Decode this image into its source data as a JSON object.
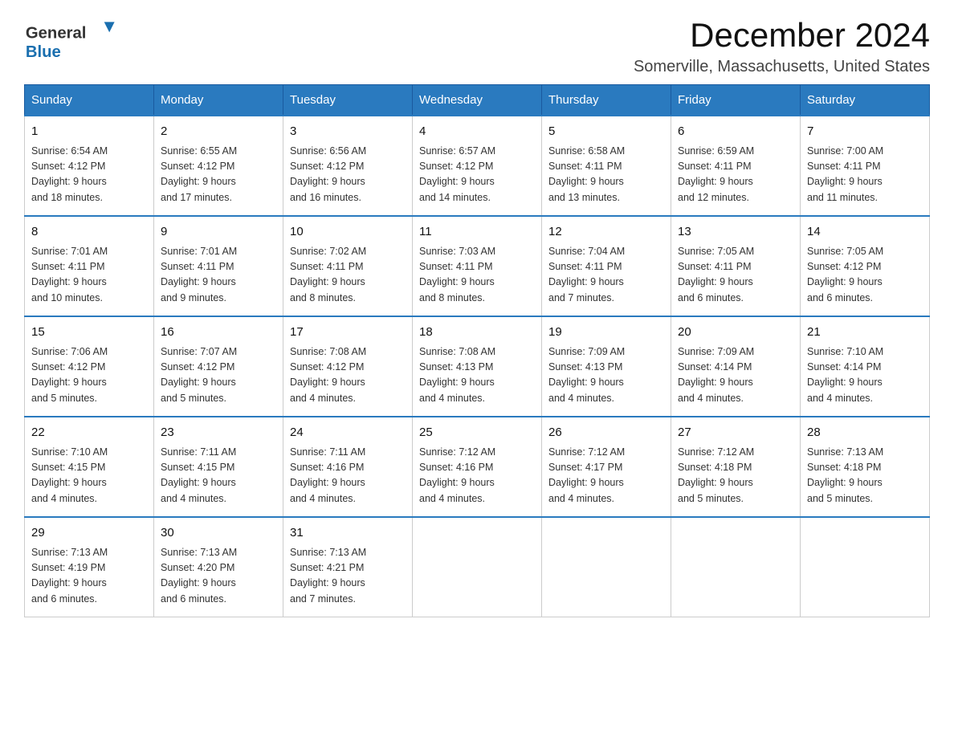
{
  "header": {
    "logo_line1": "General",
    "logo_line2": "Blue",
    "title": "December 2024",
    "subtitle": "Somerville, Massachusetts, United States"
  },
  "days_of_week": [
    "Sunday",
    "Monday",
    "Tuesday",
    "Wednesday",
    "Thursday",
    "Friday",
    "Saturday"
  ],
  "weeks": [
    [
      {
        "day": "1",
        "sunrise": "6:54 AM",
        "sunset": "4:12 PM",
        "daylight": "9 hours and 18 minutes."
      },
      {
        "day": "2",
        "sunrise": "6:55 AM",
        "sunset": "4:12 PM",
        "daylight": "9 hours and 17 minutes."
      },
      {
        "day": "3",
        "sunrise": "6:56 AM",
        "sunset": "4:12 PM",
        "daylight": "9 hours and 16 minutes."
      },
      {
        "day": "4",
        "sunrise": "6:57 AM",
        "sunset": "4:12 PM",
        "daylight": "9 hours and 14 minutes."
      },
      {
        "day": "5",
        "sunrise": "6:58 AM",
        "sunset": "4:11 PM",
        "daylight": "9 hours and 13 minutes."
      },
      {
        "day": "6",
        "sunrise": "6:59 AM",
        "sunset": "4:11 PM",
        "daylight": "9 hours and 12 minutes."
      },
      {
        "day": "7",
        "sunrise": "7:00 AM",
        "sunset": "4:11 PM",
        "daylight": "9 hours and 11 minutes."
      }
    ],
    [
      {
        "day": "8",
        "sunrise": "7:01 AM",
        "sunset": "4:11 PM",
        "daylight": "9 hours and 10 minutes."
      },
      {
        "day": "9",
        "sunrise": "7:01 AM",
        "sunset": "4:11 PM",
        "daylight": "9 hours and 9 minutes."
      },
      {
        "day": "10",
        "sunrise": "7:02 AM",
        "sunset": "4:11 PM",
        "daylight": "9 hours and 8 minutes."
      },
      {
        "day": "11",
        "sunrise": "7:03 AM",
        "sunset": "4:11 PM",
        "daylight": "9 hours and 8 minutes."
      },
      {
        "day": "12",
        "sunrise": "7:04 AM",
        "sunset": "4:11 PM",
        "daylight": "9 hours and 7 minutes."
      },
      {
        "day": "13",
        "sunrise": "7:05 AM",
        "sunset": "4:11 PM",
        "daylight": "9 hours and 6 minutes."
      },
      {
        "day": "14",
        "sunrise": "7:05 AM",
        "sunset": "4:12 PM",
        "daylight": "9 hours and 6 minutes."
      }
    ],
    [
      {
        "day": "15",
        "sunrise": "7:06 AM",
        "sunset": "4:12 PM",
        "daylight": "9 hours and 5 minutes."
      },
      {
        "day": "16",
        "sunrise": "7:07 AM",
        "sunset": "4:12 PM",
        "daylight": "9 hours and 5 minutes."
      },
      {
        "day": "17",
        "sunrise": "7:08 AM",
        "sunset": "4:12 PM",
        "daylight": "9 hours and 4 minutes."
      },
      {
        "day": "18",
        "sunrise": "7:08 AM",
        "sunset": "4:13 PM",
        "daylight": "9 hours and 4 minutes."
      },
      {
        "day": "19",
        "sunrise": "7:09 AM",
        "sunset": "4:13 PM",
        "daylight": "9 hours and 4 minutes."
      },
      {
        "day": "20",
        "sunrise": "7:09 AM",
        "sunset": "4:14 PM",
        "daylight": "9 hours and 4 minutes."
      },
      {
        "day": "21",
        "sunrise": "7:10 AM",
        "sunset": "4:14 PM",
        "daylight": "9 hours and 4 minutes."
      }
    ],
    [
      {
        "day": "22",
        "sunrise": "7:10 AM",
        "sunset": "4:15 PM",
        "daylight": "9 hours and 4 minutes."
      },
      {
        "day": "23",
        "sunrise": "7:11 AM",
        "sunset": "4:15 PM",
        "daylight": "9 hours and 4 minutes."
      },
      {
        "day": "24",
        "sunrise": "7:11 AM",
        "sunset": "4:16 PM",
        "daylight": "9 hours and 4 minutes."
      },
      {
        "day": "25",
        "sunrise": "7:12 AM",
        "sunset": "4:16 PM",
        "daylight": "9 hours and 4 minutes."
      },
      {
        "day": "26",
        "sunrise": "7:12 AM",
        "sunset": "4:17 PM",
        "daylight": "9 hours and 4 minutes."
      },
      {
        "day": "27",
        "sunrise": "7:12 AM",
        "sunset": "4:18 PM",
        "daylight": "9 hours and 5 minutes."
      },
      {
        "day": "28",
        "sunrise": "7:13 AM",
        "sunset": "4:18 PM",
        "daylight": "9 hours and 5 minutes."
      }
    ],
    [
      {
        "day": "29",
        "sunrise": "7:13 AM",
        "sunset": "4:19 PM",
        "daylight": "9 hours and 6 minutes."
      },
      {
        "day": "30",
        "sunrise": "7:13 AM",
        "sunset": "4:20 PM",
        "daylight": "9 hours and 6 minutes."
      },
      {
        "day": "31",
        "sunrise": "7:13 AM",
        "sunset": "4:21 PM",
        "daylight": "9 hours and 7 minutes."
      },
      null,
      null,
      null,
      null
    ]
  ],
  "labels": {
    "sunrise_prefix": "Sunrise: ",
    "sunset_prefix": "Sunset: ",
    "daylight_prefix": "Daylight: "
  }
}
